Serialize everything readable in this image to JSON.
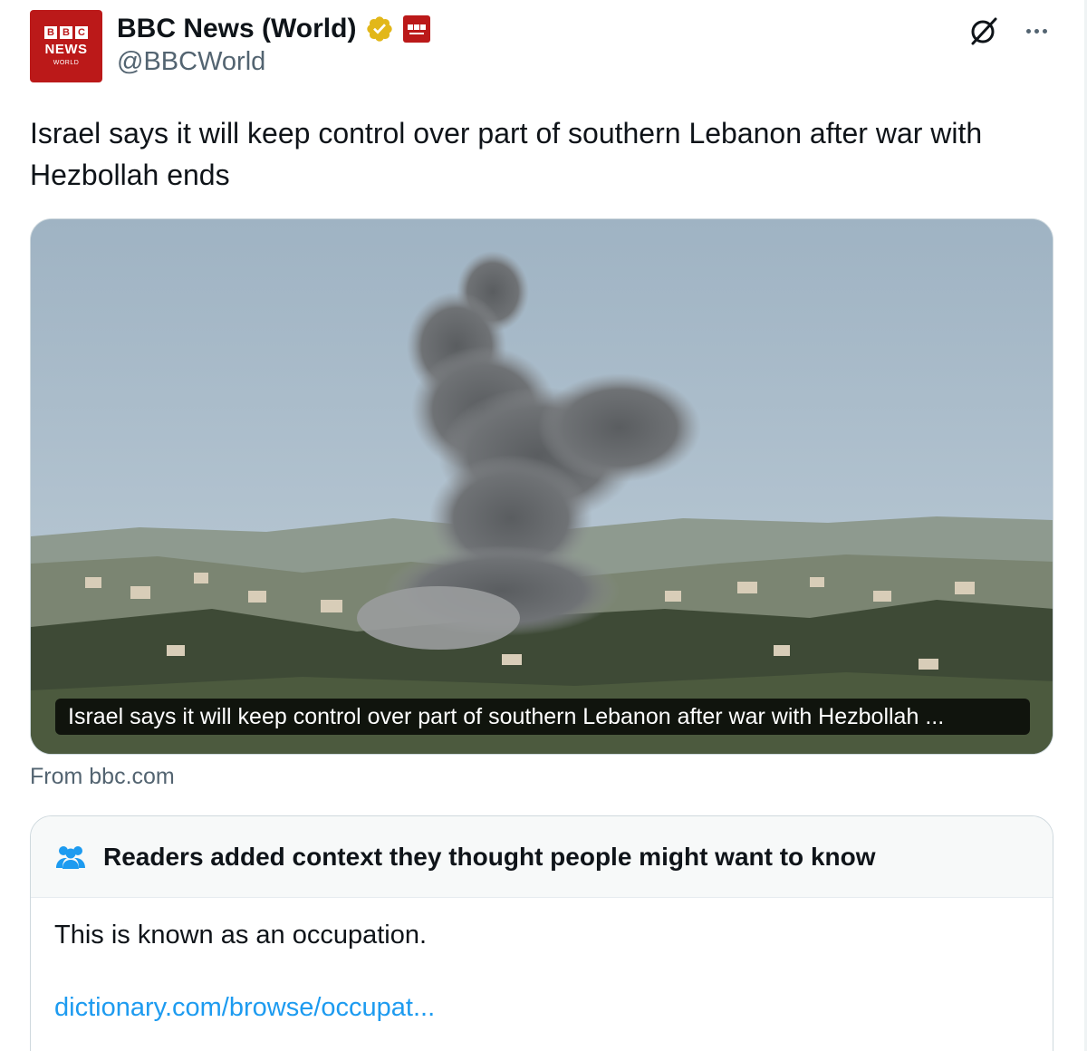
{
  "author": {
    "display_name": "BBC News (World)",
    "handle": "@BBCWorld",
    "avatar_letters": [
      "B",
      "B",
      "C"
    ],
    "avatar_news": "NEWS",
    "avatar_world": "WORLD",
    "verified": "gold-check-icon",
    "affiliation_badge": "bbc-news-badge-icon"
  },
  "tweet": {
    "text": "Israel says it will keep control over part of southern Lebanon after war with Hezbollah ends"
  },
  "media": {
    "caption": "Israel says it will keep control over part of southern Lebanon after war with Hezbollah ...",
    "source": "From bbc.com"
  },
  "community_note": {
    "title": "Readers added context they thought people might want to know",
    "body": "This is known as an occupation.",
    "link": "dictionary.com/browse/occupat..."
  },
  "colors": {
    "brand_red": "#bb1919",
    "verified_gold": "#e2b719",
    "link_blue": "#1d9bf0",
    "secondary_text": "#536471"
  },
  "icons": [
    "grok-icon",
    "more-icon",
    "people-icon"
  ]
}
